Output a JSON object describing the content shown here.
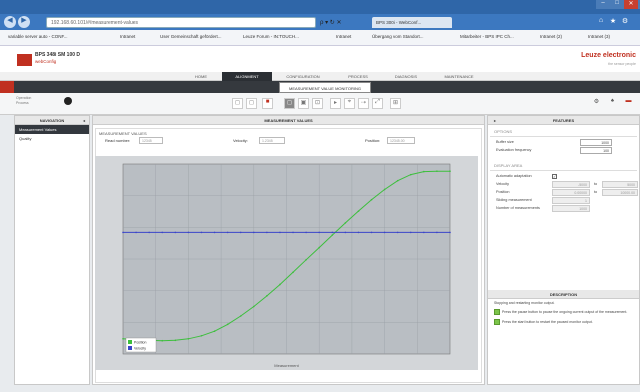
{
  "browser": {
    "address_text": "192.168.60.101/#/measurement-values",
    "address_ctrls": "ρ ▾ ↻ ✕",
    "tab_active": "BPS 300i - WebConf...",
    "favorites": [
      "variable server auto - CONF...",
      "Intranet",
      "User Gemeinschaft gefördert...",
      "Leuze Forum - IN:TOUCH...",
      "Intranet",
      "Übergang vom Standort...",
      "Mitarbeiter - BPS IPC Ch...",
      "Intranet (2)",
      "Intranet (3)"
    ],
    "nav_back": "◀",
    "nav_fwd": "▶",
    "win_min": "–",
    "win_max": "□",
    "win_close": "✕",
    "home_icon": "⌂",
    "star_icon": "★",
    "settings_icon": "⚙"
  },
  "app": {
    "device_name": "BPS 348i SM 100 D",
    "device_sub": "webConfig",
    "brand": "Leuze electronic",
    "brand_sub": "the sensor people",
    "nav_tabs": [
      "HOME",
      "ALIGNMENT",
      "CONFIGURATION",
      "PROCESS",
      "DIAGNOSIS",
      "MAINTENANCE"
    ],
    "active_tab_index": 1,
    "sub_tab": "MEASUREMENT VALUE MONITORING",
    "operating_mode_label": "Operation",
    "process_label": "Process"
  },
  "navigation": {
    "title": "NAVIGATION",
    "collapse": "◂",
    "items": [
      "Measurement Values",
      "Quality"
    ]
  },
  "center": {
    "title": "MEASUREMENT VALUES",
    "box_title": "MEASUREMENT VALUES",
    "fields": {
      "tape_label": "Read number:",
      "tape_value": "12345",
      "velocity_label": "Velocity:",
      "velocity_value": "1.2345",
      "position_label": "Position:",
      "position_value": "12345.00"
    }
  },
  "features": {
    "title": "FEATURES",
    "collapse": "▸",
    "options_title": "OPTIONS",
    "buffer_size_label": "Buffer size",
    "buffer_size_value": "1000",
    "eval_freq_label": "Evaluation frequency",
    "eval_freq_value": "100",
    "display_title": "DISPLAY AREA",
    "auto_scale_label": "Automatic adaptation",
    "auto_scale_check": "✓",
    "velocity_label": "Velocity",
    "velocity_min": "-5000",
    "velocity_max": "5000",
    "position_label": "Position",
    "position_min": "0.00000",
    "position_max": "10000.00",
    "sliding_label": "Sliding measurement",
    "sliding_value": "1",
    "num_label": "Number of measurements",
    "num_value": "1000",
    "to": "to",
    "desc_title": "DESCRIPTION",
    "desc_text": "Stopping and restarting monitor output.",
    "desc_items": [
      "Press the pause button to pause the ongoing current output of the measurement.",
      "Press the start button to restart the paused monitor output."
    ]
  },
  "toolbar": {
    "left": [
      "◻",
      "◻",
      "■",
      "◻",
      "▣",
      "⊡",
      "▸",
      "⌖",
      "⇢",
      "⤢",
      "⊞"
    ],
    "right": [
      "⚙",
      "♠",
      "▬"
    ]
  },
  "chart_data": {
    "type": "line",
    "title": "",
    "xlabel": "Measurement",
    "ylabel_left": "",
    "ylabel_right": "",
    "x": [
      0,
      20,
      40,
      60,
      80,
      100,
      120,
      140,
      160,
      180,
      200,
      220,
      240,
      260,
      280,
      300,
      320,
      340,
      360,
      380,
      400,
      420,
      440,
      460,
      480,
      500
    ],
    "series": [
      {
        "name": "Position",
        "color": "#3cbf3c",
        "values": [
          400,
          380,
          360,
          350,
          360,
          400,
          480,
          600,
          780,
          1000,
          1250,
          1530,
          1830,
          2150,
          2480,
          2800,
          3130,
          3450,
          3760,
          4060,
          4330,
          4560,
          4720,
          4800,
          4810,
          4810
        ]
      },
      {
        "name": "Velocity",
        "color": "#3a45c8",
        "values": [
          3200,
          3200,
          3200,
          3200,
          3200,
          3200,
          3200,
          3200,
          3200,
          3200,
          3200,
          3200,
          3200,
          3200,
          3200,
          3200,
          3200,
          3200,
          3200,
          3200,
          3200,
          3200,
          3200,
          3200,
          3200,
          3200
        ]
      }
    ],
    "xlim": [
      0,
      500
    ],
    "ylim": [
      0,
      5000
    ],
    "grid": true,
    "legend": "bottom-left"
  }
}
